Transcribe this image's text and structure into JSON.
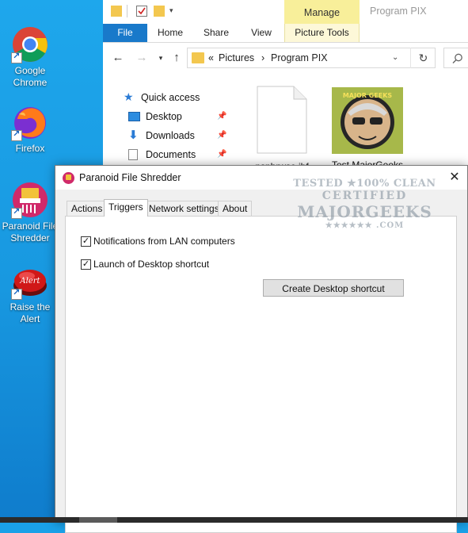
{
  "desktop": {
    "icons": [
      {
        "label_line1": "Google",
        "label_line2": "Chrome"
      },
      {
        "label_line1": "Firefox",
        "label_line2": ""
      },
      {
        "label_line1": "Paranoid File",
        "label_line2": "Shredder"
      },
      {
        "label_line1": "Raise the",
        "label_line2": "Alert"
      }
    ],
    "alert_icon_text": "Alert"
  },
  "explorer": {
    "window_title": "Program PIX",
    "manage_tab": "Manage",
    "ribbon_tabs": [
      "File",
      "Home",
      "Share",
      "View",
      "Picture Tools"
    ],
    "address": {
      "prefix": "«",
      "crumb1": "Pictures",
      "separator": "›",
      "crumb2": "Program PIX"
    },
    "nav": [
      {
        "label": "Quick access"
      },
      {
        "label": "Desktop"
      },
      {
        "label": "Downloads"
      },
      {
        "label": "Documents"
      }
    ],
    "files": [
      {
        "name": "psphrwse.ibf"
      },
      {
        "name": "Test MajorGeeks"
      }
    ]
  },
  "dialog": {
    "title": "Paranoid File Shredder",
    "close_glyph": "✕",
    "tabs": [
      "Actions",
      "Triggers",
      "Network settings",
      "About"
    ],
    "active_tab": "Triggers",
    "checks": [
      {
        "label": "Notifications from LAN computers",
        "checked": true
      },
      {
        "label": "Launch of Desktop shortcut",
        "checked": true
      }
    ],
    "create_shortcut_label": "Create Desktop shortcut"
  },
  "watermark": {
    "line1": "TESTED ★100% CLEAN",
    "line2": "CERTIFIED",
    "line3": "MAJORGEEKS",
    "line4": "★★★★★★ .COM"
  },
  "colors": {
    "file_tab": "#1979ca",
    "manage": "#f8ef9a",
    "desktop": "#1aa1e8"
  }
}
